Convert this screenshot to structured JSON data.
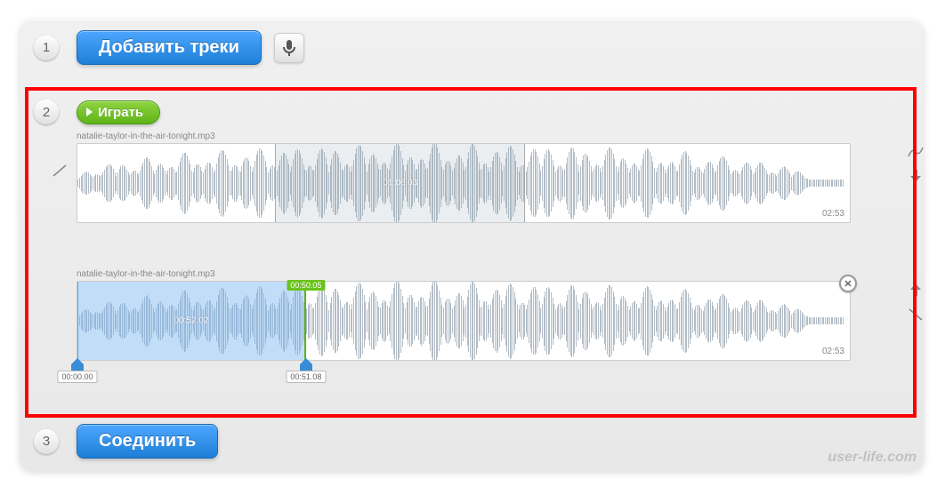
{
  "step1": {
    "num": "1",
    "addLabel": "Добавить треки"
  },
  "step2": {
    "num": "2",
    "playLabel": "Играть",
    "track1": {
      "filename": "natalie-taylor-in-the-air-tonight.mp3",
      "duration": "02:53",
      "selection": {
        "startPct": 25.6,
        "endPct": 58.0,
        "midLabel": "01:06.03"
      }
    },
    "track2": {
      "filename": "natalie-taylor-in-the-air-tonight.mp3",
      "duration": "02:53",
      "selection": {
        "startPct": 0,
        "endPct": 29.6,
        "midLabel": "00:52.02",
        "markerLabel": "00:50.05",
        "startHandle": "00:00.00",
        "endHandle": "00:51.08"
      }
    }
  },
  "step3": {
    "num": "3",
    "joinLabel": "Соединить"
  },
  "watermark": "user-life.com"
}
